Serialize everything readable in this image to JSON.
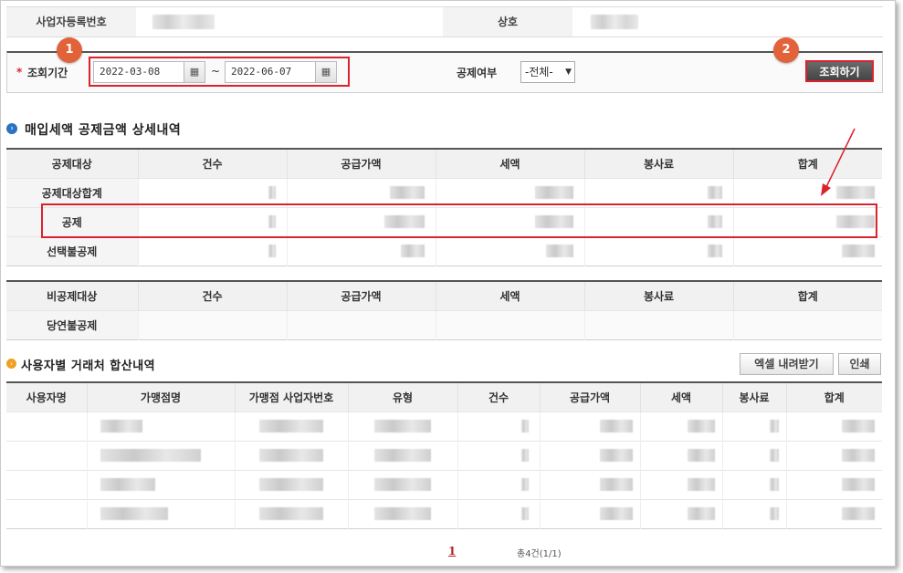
{
  "info": {
    "biz_no_label": "사업자등록번호",
    "company_label": "상호"
  },
  "search": {
    "period_label": "조회기간",
    "required_mark": "*",
    "start_date": "2022-03-08",
    "end_date": "2022-06-07",
    "tilde": "~",
    "deduct_label": "공제여부",
    "deduct_selected": "-전체-",
    "query_button": "조회하기",
    "calendar_glyph": "▦"
  },
  "annotations": {
    "badge1": "1",
    "badge2": "2",
    "accent": "#d9232d"
  },
  "section1": {
    "title": "매입세액 공제금액 상세내역",
    "headers": [
      "공제대상",
      "건수",
      "공급가액",
      "세액",
      "봉사료",
      "합계"
    ],
    "rows": [
      "공제대상합계",
      "공제",
      "선택불공제"
    ]
  },
  "section2": {
    "headers": [
      "비공제대상",
      "건수",
      "공급가액",
      "세액",
      "봉사료",
      "합계"
    ],
    "rows": [
      "당연불공제"
    ]
  },
  "section3": {
    "title": "사용자별 거래처 합산내역",
    "excel_button": "엑셀 내려받기",
    "print_button": "인쇄",
    "headers": [
      "사용자명",
      "가맹점명",
      "가맹점 사업자번호",
      "유형",
      "건수",
      "공급가액",
      "세액",
      "봉사료",
      "합계"
    ]
  },
  "pagination": {
    "current_page": "1",
    "total": "총4건(1/1)"
  }
}
